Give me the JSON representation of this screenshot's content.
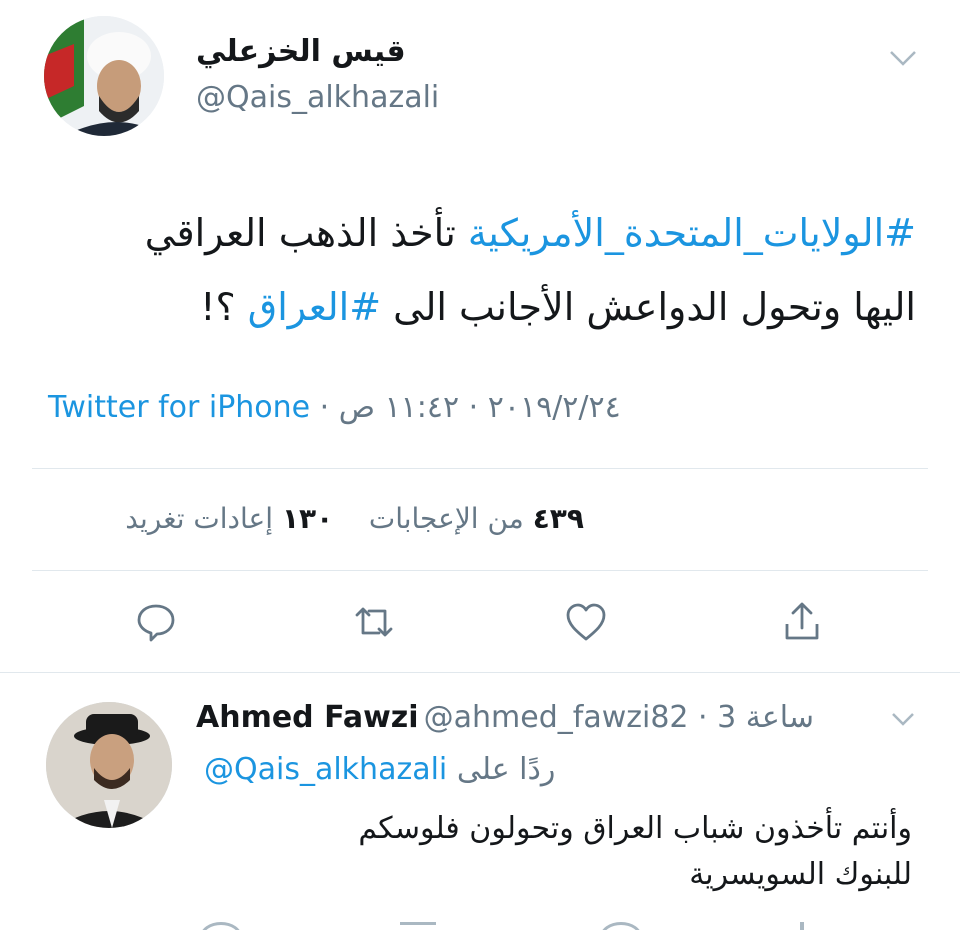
{
  "tweet": {
    "author_name": "قيس الخزعلي",
    "author_handle": "@Qais_alkhazali",
    "hashtag_1": "#الولايات_المتحدة_الأمريكية",
    "text_1": " تأخذ الذهب العراقي",
    "text_2": "اليها وتحول الدواعش الأجانب الى ",
    "hashtag_2": "#العراق",
    "text_3": " ؟!",
    "source": "Twitter for iPhone",
    "timestamp": " · ٢٠١٩/٢/٢٤ · ١١:٤٢ ص",
    "likes_count": "٤٣٩",
    "likes_label": "من الإعجابات",
    "retweets_count": "١٣٠",
    "retweets_label": "إعادات تغريد"
  },
  "actions": {
    "reply_icon": "reply-icon",
    "retweet_icon": "retweet-icon",
    "like_icon": "heart-icon",
    "share_icon": "share-icon"
  },
  "reply": {
    "author_name": "Ahmed Fawzi",
    "author_handle": "@ahmed_fawzi82",
    "time": " · 3 ساعة",
    "replying_to_label": "ردًا على",
    "replying_to_handle": "@Qais_alkhazali",
    "text_1": "وأنتم تأخذون شباب العراق وتحولون فلوسكم",
    "text_2": "للبنوك السويسرية"
  },
  "colors": {
    "link": "#1b95e0",
    "secondary_text": "#657786",
    "divider": "#e1e8ed"
  }
}
